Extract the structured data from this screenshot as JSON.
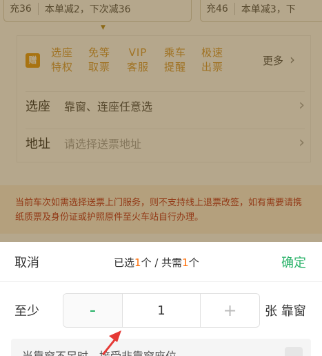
{
  "coupons": [
    {
      "price": "充36",
      "desc": "本单减2，下次减36"
    },
    {
      "price": "充46",
      "desc": "本单减3，下"
    }
  ],
  "services": {
    "vip_badge": "赠",
    "items": [
      {
        "line1": "选座",
        "line2": "特权"
      },
      {
        "line1": "免等",
        "line2": "取票"
      },
      {
        "line1": "VIP",
        "line2": "客服"
      },
      {
        "line1": "乘车",
        "line2": "提醒"
      },
      {
        "line1": "极速",
        "line2": "出票"
      }
    ],
    "more_label": "更多",
    "accent_color": "#d9a043"
  },
  "fields": {
    "seat": {
      "label": "选座",
      "value": "靠窗、连座任意选"
    },
    "address": {
      "label": "地址",
      "placeholder": "请选择送票地址"
    }
  },
  "notice": "当前车次如需选择送票上门服务，则不支持线上退票改签，如有需要请携纸质票及身份证或护照原件至火车站自行办理。",
  "sheet": {
    "cancel_label": "取消",
    "confirm_label": "确定",
    "status_prefix": "已选",
    "selected": "1",
    "status_mid": "个 / 共需",
    "needed": "1",
    "status_suffix": "个",
    "atleast_label": "至少",
    "minus_label": "-",
    "quantity": "1",
    "plus_label": "+",
    "unit_label": "张 靠窗",
    "hint": "当靠窗不足时，接受非靠窗座位",
    "confirm_color": "#2bb36a",
    "highlight_color": "#ff6a00"
  }
}
